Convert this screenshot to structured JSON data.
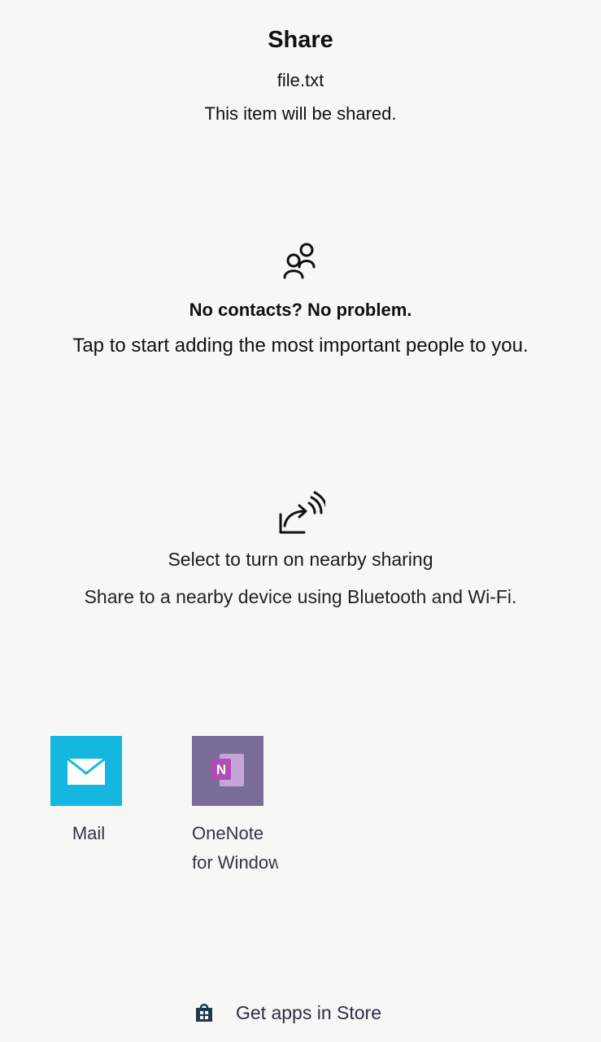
{
  "header": {
    "title": "Share",
    "filename": "file.txt",
    "subtitle": "This item will be shared."
  },
  "contacts": {
    "icon": "people-icon",
    "heading": "No contacts? No problem.",
    "description": "Tap to start adding the most important people to you."
  },
  "nearby": {
    "icon": "nearby-share-icon",
    "heading": "Select to turn on nearby sharing",
    "description": "Share to a nearby device using Bluetooth and Wi-Fi."
  },
  "apps": [
    {
      "name": "Mail",
      "icon": "mail-icon",
      "color": "#13b7e0"
    },
    {
      "name": "OneNote for Windows",
      "line1": "OneNote",
      "line2": "for Windows",
      "icon": "onenote-icon",
      "color": "#7a6d99"
    }
  ],
  "store": {
    "label": "Get apps in Store",
    "icon": "store-icon"
  }
}
